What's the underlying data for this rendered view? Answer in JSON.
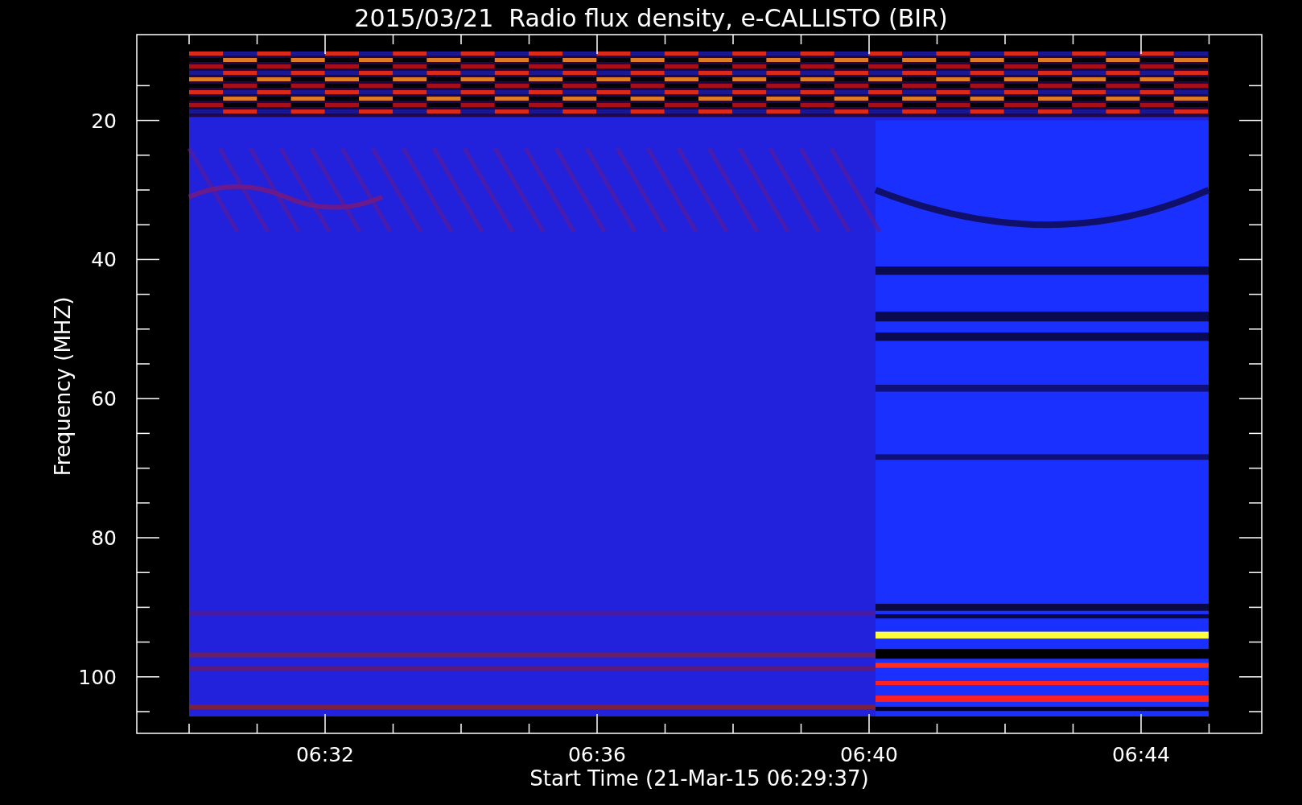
{
  "title": "2015/03/21  Radio flux density, e-CALLISTO (BIR)",
  "y_axis": {
    "label": "Frequency (MHZ)",
    "ticks": [
      "20",
      "40",
      "60",
      "80",
      "100"
    ]
  },
  "x_axis": {
    "label": "Start Time (21-Mar-15 06:29:37)",
    "ticks": [
      "06:32",
      "06:36",
      "06:40",
      "06:44"
    ]
  }
}
